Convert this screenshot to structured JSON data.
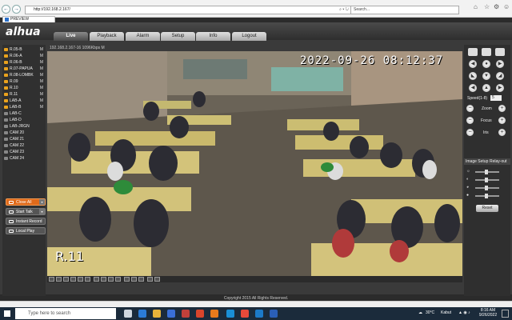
{
  "browser": {
    "address": "http://192.168.2.167/",
    "search_placeholder": "Search...",
    "tab_title": "PREVIEW",
    "back_glyph": "←",
    "forward_glyph": "→",
    "addr_buttons": "⌕ ▾ ↻",
    "home_icon": "⌂",
    "star_icon": "☆",
    "settings_icon": "⚙",
    "smiley_icon": "☺"
  },
  "app": {
    "logo": "alhua",
    "menu": [
      {
        "label": "Live",
        "active": true
      },
      {
        "label": "Playback"
      },
      {
        "label": "Alarm"
      },
      {
        "label": "Setup"
      },
      {
        "label": "Info"
      },
      {
        "label": "Logout"
      }
    ],
    "channels": [
      {
        "name": "R.05-B",
        "m": "M"
      },
      {
        "name": "R.06-A",
        "m": "M"
      },
      {
        "name": "R.06-B",
        "m": "M"
      },
      {
        "name": "R.07-PAPUA",
        "m": "M"
      },
      {
        "name": "R.08-LOMBK",
        "m": "M"
      },
      {
        "name": "R.09",
        "m": "M"
      },
      {
        "name": "R.10",
        "m": "M"
      },
      {
        "name": "R.11",
        "m": "M"
      },
      {
        "name": "LAB-A",
        "m": "M"
      },
      {
        "name": "LAB-B",
        "m": "M"
      },
      {
        "name": "LAB-C",
        "m": ""
      },
      {
        "name": "LAB-D",
        "m": ""
      },
      {
        "name": "LAB-JRGN",
        "m": ""
      },
      {
        "name": "CAM 20",
        "m": ""
      },
      {
        "name": "CAM 21",
        "m": ""
      },
      {
        "name": "CAM 22",
        "m": ""
      },
      {
        "name": "CAM 23",
        "m": ""
      },
      {
        "name": "CAM 24",
        "m": ""
      }
    ],
    "buttons": {
      "close_all": "Close All",
      "start_talk": "Start Talk",
      "instant_record": "Instant Record",
      "local_play": "Local Play"
    },
    "video": {
      "title": "192.168.2.167-16 1096Kbps M",
      "timestamp": "2022-09-26 08:12:37",
      "room_label": "R.11"
    },
    "ptz": {
      "speed_label": "Speed(1-8)",
      "speed_value": "5",
      "zoom": "Zoom",
      "focus": "Focus",
      "iris": "Iris",
      "minus": "−",
      "plus": "+"
    },
    "image_setup": "Image Setup",
    "relay_out": "Relay-out",
    "reset": "Reset",
    "copyright": "Copyright 2015 All Rights Reserved."
  },
  "taskbar": {
    "search_placeholder": "Type here to search",
    "temperature": "30°C",
    "weather": "Kabut",
    "time": "8:16 AM",
    "date": "9/26/2022"
  }
}
